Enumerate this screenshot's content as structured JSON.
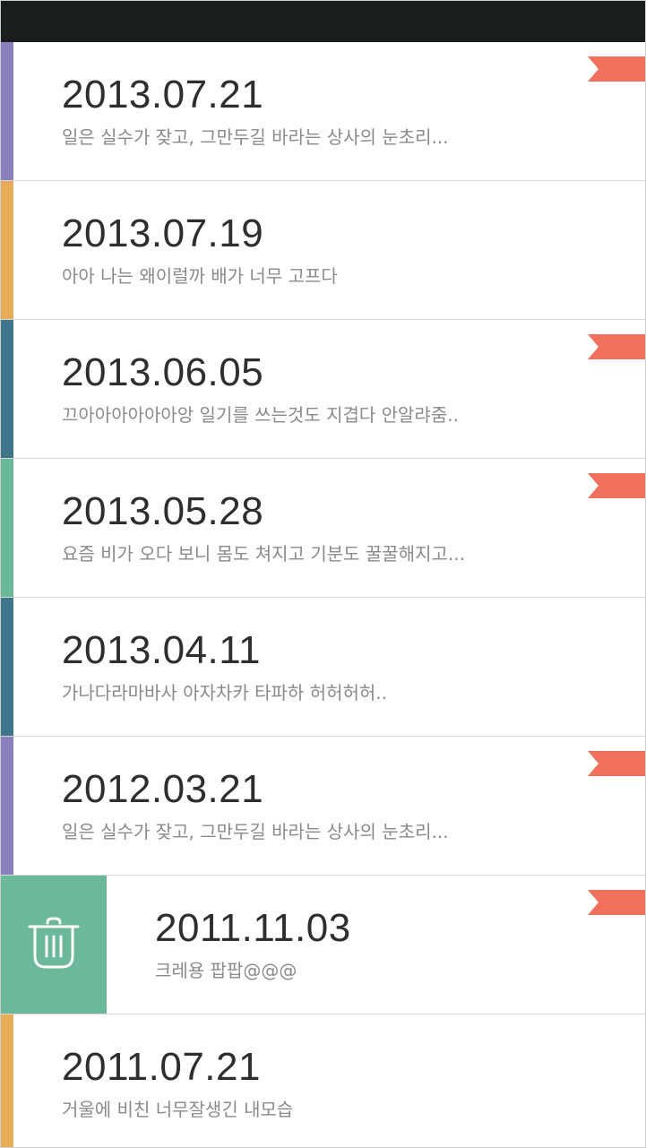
{
  "colors": {
    "purple": "#8a80bd",
    "orange": "#e8ab58",
    "teal": "#3e758a",
    "green": "#6cb89a",
    "bookmark": "#ef705c",
    "status_bar": "#1b1c1c"
  },
  "entries": [
    {
      "date": "2013.07.21",
      "preview": "일은 실수가 잦고, 그만두길 바라는 상사의 눈초리...",
      "color": "#8a80bd",
      "bookmarked": true
    },
    {
      "date": "2013.07.19",
      "preview": "아아 나는 왜이럴까 배가 너무 고프다",
      "color": "#e8ab58",
      "bookmarked": false
    },
    {
      "date": "2013.06.05",
      "preview": "끄아아아아아아앙 일기를 쓰는것도 지겹다 안알랴줌..",
      "color": "#3e758a",
      "bookmarked": true
    },
    {
      "date": "2013.05.28",
      "preview": "요즘 비가 오다 보니 몸도 쳐지고 기분도 꿀꿀해지고...",
      "color": "#6cb89a",
      "bookmarked": true
    },
    {
      "date": "2013.04.11",
      "preview": "가나다라마바사 아자차카 타파하 허허허허..",
      "color": "#3e758a",
      "bookmarked": false
    },
    {
      "date": "2012.03.21",
      "preview": "일은 실수가 잦고, 그만두길 바라는 상사의 눈초리...",
      "color": "#8a80bd",
      "bookmarked": true
    },
    {
      "date": "2011.11.03",
      "preview": "크레용 팝팝@@@",
      "color": "#6cb89a",
      "bookmarked": true,
      "swiped": true,
      "action_icon": "trash-icon"
    },
    {
      "date": "2011.07.21",
      "preview": "거울에 비친 너무잘생긴 내모습",
      "color": "#e8ab58",
      "bookmarked": false
    }
  ]
}
